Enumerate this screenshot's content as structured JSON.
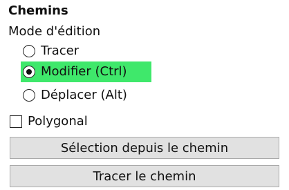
{
  "panel": {
    "title": "Chemins",
    "mode_label": "Mode d'édition",
    "modes": [
      {
        "label": "Tracer",
        "checked": false
      },
      {
        "label": "Modifier (Ctrl)",
        "checked": true,
        "highlight": "#3fe86b"
      },
      {
        "label": "Déplacer (Alt)",
        "checked": false
      }
    ],
    "polygonal": {
      "label": "Polygonal",
      "checked": false
    },
    "buttons": {
      "selection_from_path": "Sélection depuis le chemin",
      "stroke_path": "Tracer le chemin"
    }
  }
}
